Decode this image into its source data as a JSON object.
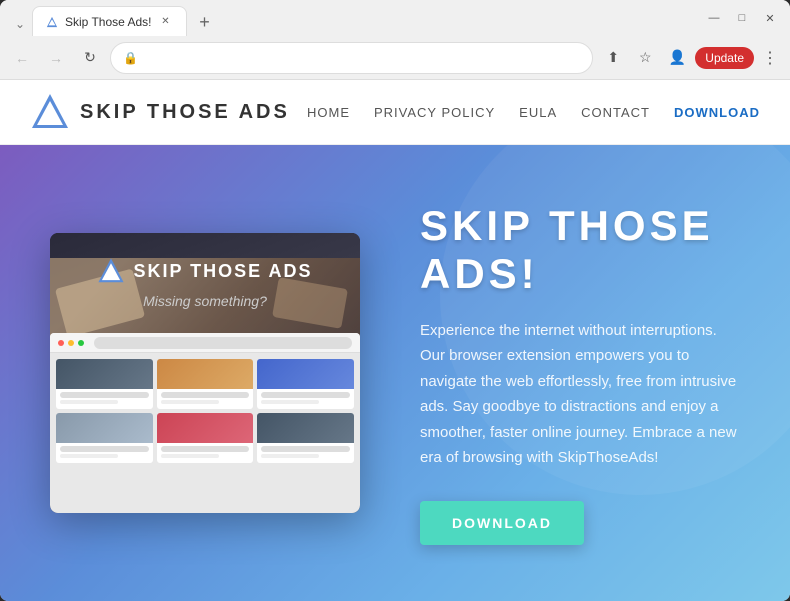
{
  "browser": {
    "tab": {
      "title": "Skip Those Ads!",
      "favicon_label": "triangle-favicon"
    },
    "new_tab_label": "+",
    "window_controls": {
      "minimize": "—",
      "maximize": "□",
      "close": "✕",
      "chevron": "⌄"
    },
    "nav": {
      "back_label": "←",
      "forward_label": "→",
      "refresh_label": "↻",
      "lock_label": "🔒",
      "address": "",
      "share_label": "⬆",
      "star_label": "☆",
      "profile_label": "👤",
      "update_label": "Update",
      "menu_label": "⋮"
    }
  },
  "site": {
    "logo_text": "SKIP  THOSE  ADS",
    "nav": {
      "home": "Home",
      "privacy": "Privacy Policy",
      "eula": "EULA",
      "contact": "Contact",
      "download": "DOWNLOAD"
    },
    "hero": {
      "screenshot_text": "SKIP  THOSE  ADS",
      "screenshot_subtitle": "Missing something?",
      "title": "SKIP THOSE ADS!",
      "description": "Experience the internet without interruptions. Our browser extension empowers you to navigate the web effortlessly, free from intrusive ads. Say goodbye to distractions and enjoy a smoother, faster online journey. Embrace a new era of browsing with SkipThoseAds!",
      "download_btn": "DOWNLOAD"
    }
  },
  "colors": {
    "hero_gradient_start": "#7c5cbf",
    "hero_gradient_end": "#7ec8ea",
    "download_btn": "#4dd9c0",
    "nav_download": "#1a6cc4",
    "update_btn": "#d32f2f"
  }
}
